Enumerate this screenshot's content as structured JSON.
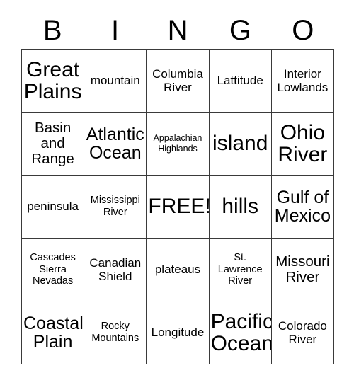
{
  "card": {
    "header": {
      "letters": [
        "B",
        "I",
        "N",
        "G",
        "O"
      ]
    },
    "grid": {
      "rows": 5,
      "columns": 5,
      "border_color": "#3a3a3a",
      "background_color": "#ffffff",
      "text_color": "#000000",
      "cells": [
        [
          {
            "text": "Great\nPlains",
            "size": "xxl"
          },
          {
            "text": "mountain",
            "size": "md"
          },
          {
            "text": "Columbia\nRiver",
            "size": "md"
          },
          {
            "text": "Lattitude",
            "size": "md"
          },
          {
            "text": "Interior\nLowlands",
            "size": "md"
          }
        ],
        [
          {
            "text": "Basin\nand\nRange",
            "size": "lg"
          },
          {
            "text": "Atlantic\nOcean",
            "size": "xl"
          },
          {
            "text": "Appalachian\nHighlands",
            "size": "xs"
          },
          {
            "text": "island",
            "size": "xxl"
          },
          {
            "text": "Ohio\nRiver",
            "size": "xxl"
          }
        ],
        [
          {
            "text": "peninsula",
            "size": "md"
          },
          {
            "text": "Mississippi\nRiver",
            "size": "sm"
          },
          {
            "text": "FREE!",
            "size": "xxl"
          },
          {
            "text": "hills",
            "size": "xxl"
          },
          {
            "text": "Gulf of\nMexico",
            "size": "xl"
          }
        ],
        [
          {
            "text": "Cascades\nSierra\nNevadas",
            "size": "sm"
          },
          {
            "text": "Canadian\nShield",
            "size": "md"
          },
          {
            "text": "plateaus",
            "size": "md"
          },
          {
            "text": "St.\nLawrence\nRiver",
            "size": "sm"
          },
          {
            "text": "Missouri\nRiver",
            "size": "lg"
          }
        ],
        [
          {
            "text": "Coastal\nPlain",
            "size": "xl"
          },
          {
            "text": "Rocky\nMountains",
            "size": "sm"
          },
          {
            "text": "Longitude",
            "size": "md"
          },
          {
            "text": "Pacific\nOcean",
            "size": "xxl"
          },
          {
            "text": "Colorado\nRiver",
            "size": "md"
          }
        ]
      ]
    }
  }
}
